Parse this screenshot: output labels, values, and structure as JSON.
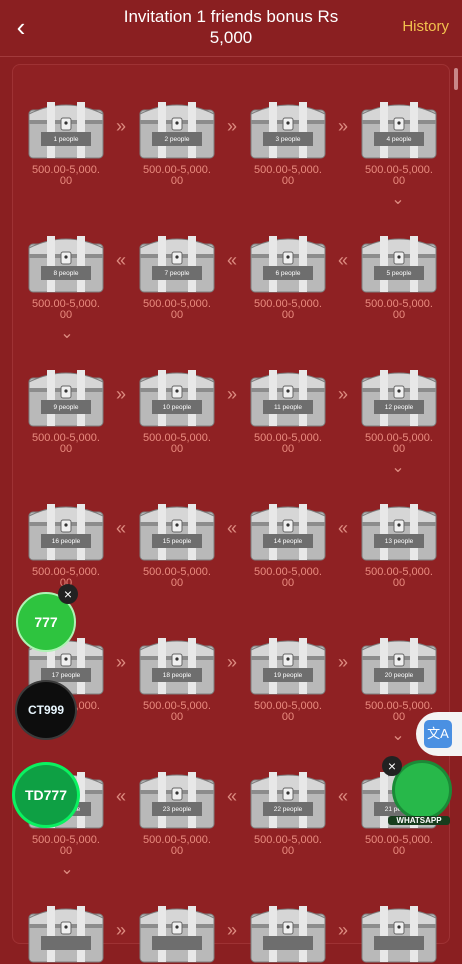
{
  "header": {
    "back_icon": "chevron-left-icon",
    "title_line1": "Invitation 1 friends bonus Rs",
    "title_line2": "5,000",
    "history_label": "History"
  },
  "rewards": [
    {
      "people": "1 people",
      "amount_line1": "500.00-5,000.",
      "amount_line2": "00"
    },
    {
      "people": "2 people",
      "amount_line1": "500.00-5,000.",
      "amount_line2": "00"
    },
    {
      "people": "3 people",
      "amount_line1": "500.00-5,000.",
      "amount_line2": "00"
    },
    {
      "people": "4 people",
      "amount_line1": "500.00-5,000.",
      "amount_line2": "00"
    },
    {
      "people": "5 people",
      "amount_line1": "500.00-5,000.",
      "amount_line2": "00"
    },
    {
      "people": "6 people",
      "amount_line1": "500.00-5,000.",
      "amount_line2": "00"
    },
    {
      "people": "7 people",
      "amount_line1": "500.00-5,000.",
      "amount_line2": "00"
    },
    {
      "people": "8 people",
      "amount_line1": "500.00-5,000.",
      "amount_line2": "00"
    },
    {
      "people": "9 people",
      "amount_line1": "500.00-5,000.",
      "amount_line2": "00"
    },
    {
      "people": "10 people",
      "amount_line1": "500.00-5,000.",
      "amount_line2": "00"
    },
    {
      "people": "11 people",
      "amount_line1": "500.00-5,000.",
      "amount_line2": "00"
    },
    {
      "people": "12 people",
      "amount_line1": "500.00-5,000.",
      "amount_line2": "00"
    },
    {
      "people": "13 people",
      "amount_line1": "500.00-5,000.",
      "amount_line2": "00"
    },
    {
      "people": "14 people",
      "amount_line1": "500.00-5,000.",
      "amount_line2": "00"
    },
    {
      "people": "15 people",
      "amount_line1": "500.00-5,000.",
      "amount_line2": "00"
    },
    {
      "people": "16 people",
      "amount_line1": "500.00-5,000.",
      "amount_line2": "00"
    },
    {
      "people": "17 people",
      "amount_line1": "500.00-5,000.",
      "amount_line2": "00"
    },
    {
      "people": "18 people",
      "amount_line1": "500.00-5,000.",
      "amount_line2": "00"
    },
    {
      "people": "19 people",
      "amount_line1": "500.00-5,000.",
      "amount_line2": "00"
    },
    {
      "people": "20 people",
      "amount_line1": "500.00-5,000.",
      "amount_line2": "00"
    },
    {
      "people": "21 people",
      "amount_line1": "500.00-5,000.",
      "amount_line2": "00"
    },
    {
      "people": "22 people",
      "amount_line1": "500.00-5,000.",
      "amount_line2": "00"
    },
    {
      "people": "23 people",
      "amount_line1": "500.00-5,000.",
      "amount_line2": "00"
    },
    {
      "people": "24 people",
      "amount_line1": "500.00-5,000.",
      "amount_line2": "00"
    },
    {
      "people": "",
      "amount_line1": "",
      "amount_line2": ""
    },
    {
      "people": "",
      "amount_line1": "",
      "amount_line2": ""
    },
    {
      "people": "",
      "amount_line1": "",
      "amount_line2": ""
    },
    {
      "people": "",
      "amount_line1": "",
      "amount_line2": ""
    }
  ],
  "floating_badges": {
    "badge1_text": "777",
    "badge2_text": "CT999",
    "badge3_text": "TD777",
    "whatsapp_text": "WHATSAPP",
    "close_glyph": "×",
    "translate_glyph": "文A"
  },
  "colors": {
    "background": "#8a1f21",
    "accent_history": "#f2c14e",
    "amount_text": "#e98b7f"
  }
}
